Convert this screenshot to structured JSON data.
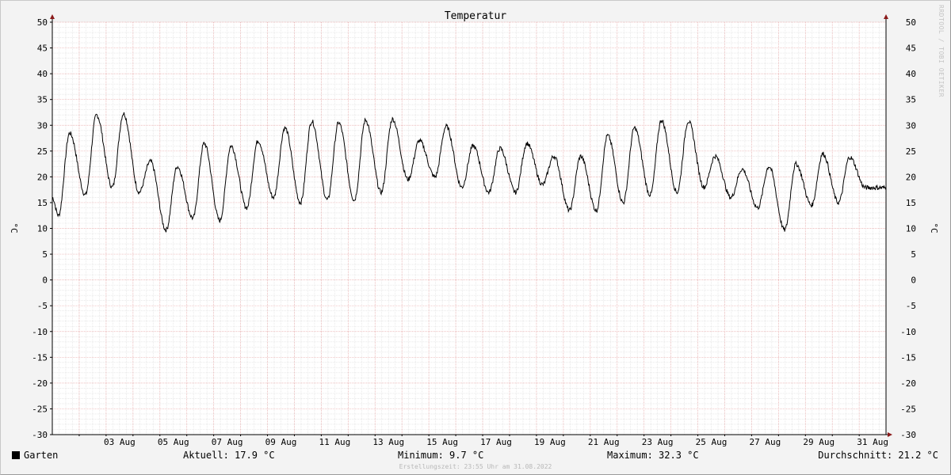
{
  "chart_data": {
    "type": "line",
    "title": "Temperatur",
    "ylabel": "°C",
    "ylabel_right": "°C",
    "ylim": [
      -30,
      50
    ],
    "y_ticks": [
      50,
      45,
      40,
      35,
      30,
      25,
      20,
      15,
      10,
      5,
      0,
      -5,
      -10,
      -15,
      -20,
      -25,
      -30
    ],
    "x_range": [
      "2022-08-01 00:00",
      "2022-08-31 23:55"
    ],
    "x_ticks": [
      "03 Aug",
      "05 Aug",
      "07 Aug",
      "09 Aug",
      "11 Aug",
      "13 Aug",
      "15 Aug",
      "17 Aug",
      "19 Aug",
      "21 Aug",
      "23 Aug",
      "25 Aug",
      "27 Aug",
      "29 Aug",
      "31 Aug"
    ],
    "x_tick_dates": [
      "2022-08-03",
      "2022-08-05",
      "2022-08-07",
      "2022-08-09",
      "2022-08-11",
      "2022-08-13",
      "2022-08-15",
      "2022-08-17",
      "2022-08-19",
      "2022-08-21",
      "2022-08-23",
      "2022-08-25",
      "2022-08-27",
      "2022-08-29",
      "2022-08-31"
    ],
    "grid": true,
    "series": [
      {
        "name": "Garten",
        "color": "#000000",
        "daily_min": [
          12.5,
          16.5,
          18.0,
          17.0,
          9.7,
          12.0,
          11.5,
          14.0,
          16.0,
          15.0,
          15.5,
          15.5,
          17.0,
          19.5,
          20.0,
          18.0,
          17.0,
          17.0,
          18.5,
          13.5,
          13.5,
          15.0,
          16.5,
          17.0,
          18.0,
          16.0,
          14.0,
          9.7,
          14.5,
          15.0,
          17.9
        ],
        "daily_max": [
          28.5,
          32.0,
          32.3,
          23.0,
          22.0,
          26.5,
          26.0,
          27.0,
          29.5,
          30.8,
          30.5,
          31.0,
          31.2,
          27.0,
          29.8,
          26.0,
          25.5,
          26.5,
          24.0,
          24.0,
          28.0,
          29.5,
          31.0,
          30.8,
          24.0,
          21.5,
          22.0,
          22.5,
          24.5,
          23.8
        ]
      }
    ]
  },
  "legend": {
    "series_label": "Garten",
    "current": "Aktuell: 17.9 °C",
    "minimum": "Minimum: 9.7 °C",
    "maximum": "Maximum: 32.3 °C",
    "average": "Durchschnitt: 21.2 °C"
  },
  "footer": {
    "created": "Erstellungszeit: 23:55 Uhr am 31.08.2022"
  },
  "watermark": "RRDTOOL / TOBI OETIKER",
  "colors": {
    "background": "#f3f3f3",
    "plot": "#ffffff",
    "minor_grid": "#dcdcdc",
    "major_grid": "#e8a8a8",
    "axis_arrow": "#8b1a1a",
    "line": "#000000"
  }
}
